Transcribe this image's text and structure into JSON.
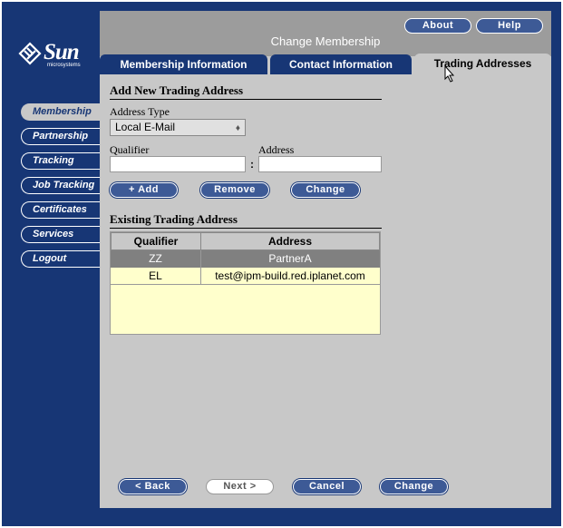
{
  "brand": {
    "name": "Sun",
    "sub": "microsystems"
  },
  "header": {
    "title": "Change Membership",
    "about_label": "About",
    "help_label": "Help"
  },
  "tabs": [
    {
      "label": "Membership Information",
      "active": false
    },
    {
      "label": "Contact Information",
      "active": false
    },
    {
      "label": "Trading Addresses",
      "active": true
    }
  ],
  "sidebar": {
    "items": [
      {
        "label": "Membership",
        "active": true
      },
      {
        "label": "Partnership",
        "active": false
      },
      {
        "label": "Tracking",
        "active": false
      },
      {
        "label": "Job Tracking",
        "active": false
      },
      {
        "label": "Certificates",
        "active": false
      },
      {
        "label": "Services",
        "active": false
      },
      {
        "label": "Logout",
        "active": false
      }
    ]
  },
  "add_section": {
    "title": "Add New Trading Address",
    "address_type_label": "Address Type",
    "address_type_value": "Local E-Mail",
    "qualifier_label": "Qualifier",
    "address_label": "Address",
    "qualifier_value": "",
    "address_value": "",
    "separator": ":",
    "add_label": "+ Add",
    "remove_label": "Remove",
    "change_label": "Change"
  },
  "existing_section": {
    "title": "Existing Trading Address",
    "columns": [
      "Qualifier",
      "Address"
    ],
    "rows": [
      {
        "qualifier": "ZZ",
        "address": "PartnerA",
        "selected": true
      },
      {
        "qualifier": "EL",
        "address": "test@ipm-build.red.iplanet.com",
        "selected": false
      }
    ]
  },
  "footer": {
    "back_label": "< Back",
    "next_label": "Next >",
    "cancel_label": "Cancel",
    "change_label": "Change"
  },
  "colors": {
    "frame": "#173675",
    "panel": "#c8c8c8",
    "header": "#9c9c9c",
    "button": "#3d5a96",
    "table_bg": "#ffffcc",
    "selected_row": "#808080"
  }
}
